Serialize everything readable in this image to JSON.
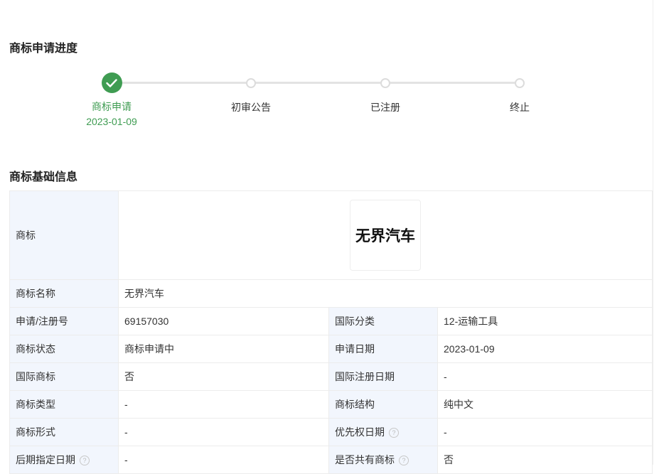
{
  "progress": {
    "title": "商标申请进度",
    "steps": [
      {
        "label": "商标申请",
        "date": "2023-01-09"
      },
      {
        "label": "初审公告"
      },
      {
        "label": "已注册"
      },
      {
        "label": "终止"
      }
    ]
  },
  "basic_info": {
    "title": "商标基础信息",
    "logo_label": "商标",
    "logo_text": "无界汽车",
    "name_label": "商标名称",
    "name_value": "无界汽车",
    "rows": [
      {
        "k1": "申请/注册号",
        "v1": "69157030",
        "k2": "国际分类",
        "v2": "12-运输工具"
      },
      {
        "k1": "商标状态",
        "v1": "商标申请中",
        "k2": "申请日期",
        "v2": "2023-01-09"
      },
      {
        "k1": "国际商标",
        "v1": "否",
        "k2": "国际注册日期",
        "v2": "-"
      },
      {
        "k1": "商标类型",
        "v1": "-",
        "k2": "商标结构",
        "v2": "纯中文"
      },
      {
        "k1": "商标形式",
        "v1": "-",
        "k2": "优先权日期",
        "v2": "-"
      },
      {
        "k1": "后期指定日期",
        "v1": "-",
        "k2": "是否共有商标",
        "v2": "否"
      }
    ],
    "help_glyph": "?"
  },
  "colors": {
    "success": "#3f9c52",
    "label_bg": "#f2f6fd"
  },
  "icons": {
    "step_done": "check-icon",
    "help": "help-circle-icon"
  }
}
